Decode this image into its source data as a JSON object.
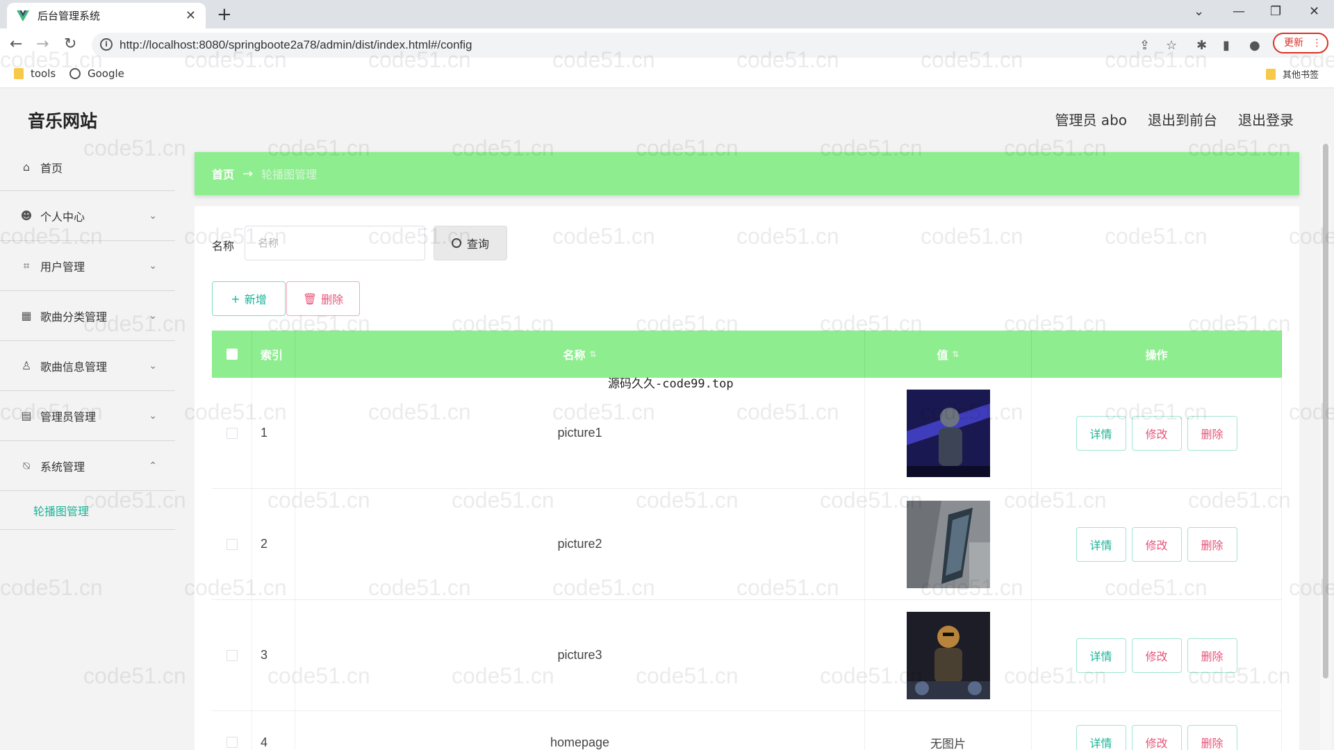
{
  "browser": {
    "tab_title": "后台管理系统",
    "url": "http://localhost:8080/springbootе2a78/admin/dist/index.html#/config",
    "update_label": "更新",
    "bookmarks": [
      {
        "label": "tools"
      },
      {
        "label": "Google"
      }
    ],
    "other_bookmarks": "其他书签"
  },
  "header": {
    "logo": "音乐网站",
    "admin_label": "管理员 abo",
    "to_front": "退出到前台",
    "logout": "退出登录"
  },
  "sidebar": {
    "items": [
      {
        "label": "首页",
        "icon": "home-icon"
      },
      {
        "label": "个人中心",
        "icon": "user-icon"
      },
      {
        "label": "用户管理",
        "icon": "crop-icon"
      },
      {
        "label": "歌曲分类管理",
        "icon": "grid-icon"
      },
      {
        "label": "歌曲信息管理",
        "icon": "person-icon"
      },
      {
        "label": "管理员管理",
        "icon": "chart-icon"
      },
      {
        "label": "系统管理",
        "icon": "bell-off-icon"
      }
    ],
    "sub_item": "轮播图管理"
  },
  "breadcrumb": {
    "home": "首页",
    "arrow": "→",
    "current": "轮播图管理"
  },
  "search": {
    "label": "名称",
    "placeholder": "名称",
    "button": "查询"
  },
  "actions": {
    "add": "新增",
    "delete": "删除"
  },
  "table": {
    "headers": {
      "index": "索引",
      "name": "名称",
      "value": "值",
      "operation": "操作"
    },
    "rows": [
      {
        "index": "1",
        "name": "picture1",
        "value": "",
        "has_image": true
      },
      {
        "index": "2",
        "name": "picture2",
        "value": "",
        "has_image": true
      },
      {
        "index": "3",
        "name": "picture3",
        "value": "",
        "has_image": true
      },
      {
        "index": "4",
        "name": "homepage",
        "value": "无图片",
        "has_image": false
      }
    ],
    "op_labels": {
      "detail": "详情",
      "edit": "修改",
      "delete": "删除"
    }
  },
  "overlay_text": "源码久久-code99.top",
  "watermark": "code51.cn",
  "colors": {
    "accent_green": "#8eee8f",
    "teal": "#18b394",
    "pink": "#e7557a"
  }
}
